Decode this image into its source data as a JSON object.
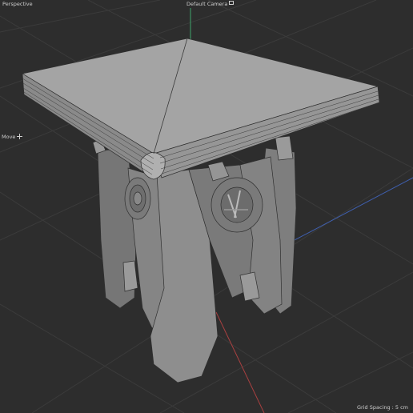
{
  "viewport": {
    "view_name": "Perspective",
    "camera_label": "Default Camera",
    "camera_icon": "camera-icon",
    "tool_label": "Move",
    "tool_icon": "move-cross-icon",
    "grid_spacing": "Grid Spacing : 5 cm"
  },
  "colors": {
    "background": "#2d2d2d",
    "grid_line": "#3a3a3a",
    "axis_y": "#3ea56a",
    "axis_x": "#a84040",
    "axis_z": "#3f5fae",
    "model_fill": "#8c8c8c",
    "wire": "#2f2f2f"
  }
}
